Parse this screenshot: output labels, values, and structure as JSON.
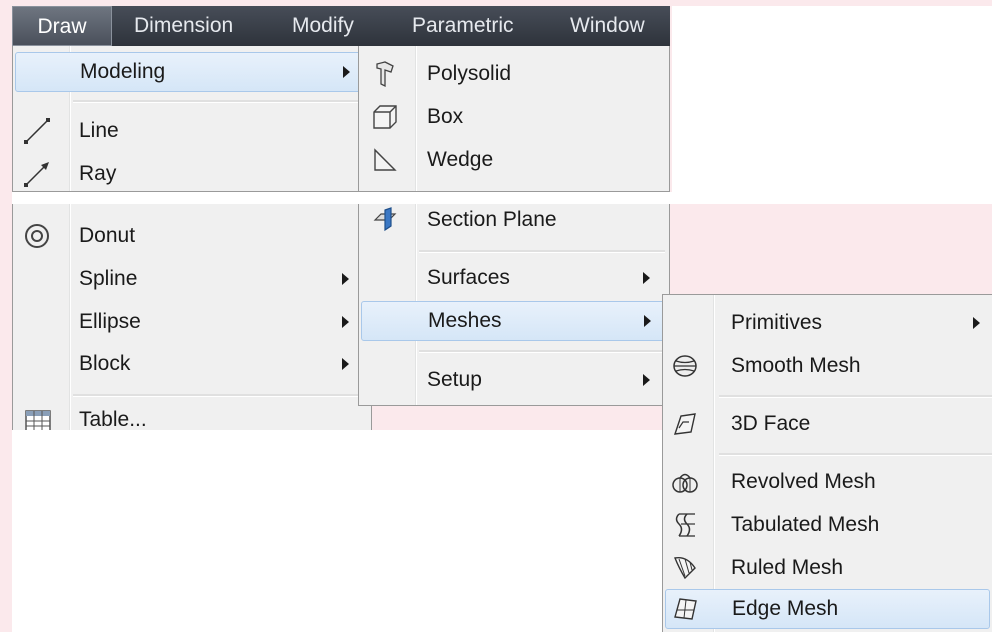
{
  "menubar": [
    "Draw",
    "Dimension",
    "Modify",
    "Parametric",
    "Window"
  ],
  "draw_menu": [
    {
      "label": "Modeling",
      "submenu": true,
      "highlight": true,
      "icon": ""
    },
    {
      "label": "Line",
      "icon": "line-icon"
    },
    {
      "label": "Ray",
      "icon": "ray-icon"
    },
    {
      "label": "Donut",
      "icon": "donut-icon"
    },
    {
      "label": "Spline",
      "submenu": true,
      "icon": ""
    },
    {
      "label": "Ellipse",
      "submenu": true,
      "icon": ""
    },
    {
      "label": "Block",
      "submenu": true,
      "icon": ""
    },
    {
      "label": "Table...",
      "icon": "table-icon"
    }
  ],
  "modeling_menu": [
    {
      "label": "Polysolid",
      "icon": "polysolid-icon"
    },
    {
      "label": "Box",
      "icon": "box-icon"
    },
    {
      "label": "Wedge",
      "icon": "wedge-icon"
    },
    {
      "label": "Section Plane",
      "icon": "section-plane-icon"
    },
    {
      "label": "Surfaces",
      "submenu": true
    },
    {
      "label": "Meshes",
      "submenu": true,
      "highlight": true
    },
    {
      "label": "Setup",
      "submenu": true
    }
  ],
  "meshes_menu": [
    {
      "label": "Primitives",
      "submenu": true
    },
    {
      "label": "Smooth Mesh",
      "icon": "smooth-mesh-icon"
    },
    {
      "label": "3D Face",
      "icon": "3d-face-icon"
    },
    {
      "label": "Revolved Mesh",
      "icon": "revolved-mesh-icon"
    },
    {
      "label": "Tabulated Mesh",
      "icon": "tabulated-mesh-icon"
    },
    {
      "label": "Ruled Mesh",
      "icon": "ruled-mesh-icon"
    },
    {
      "label": "Edge Mesh",
      "icon": "edge-mesh-icon",
      "highlight": true
    }
  ],
  "colors": {
    "menubar": "#3a3f48",
    "menu_bg": "#f0f0f0",
    "highlight": "#d5e6f7",
    "page_bg": "#fbe9ec"
  }
}
